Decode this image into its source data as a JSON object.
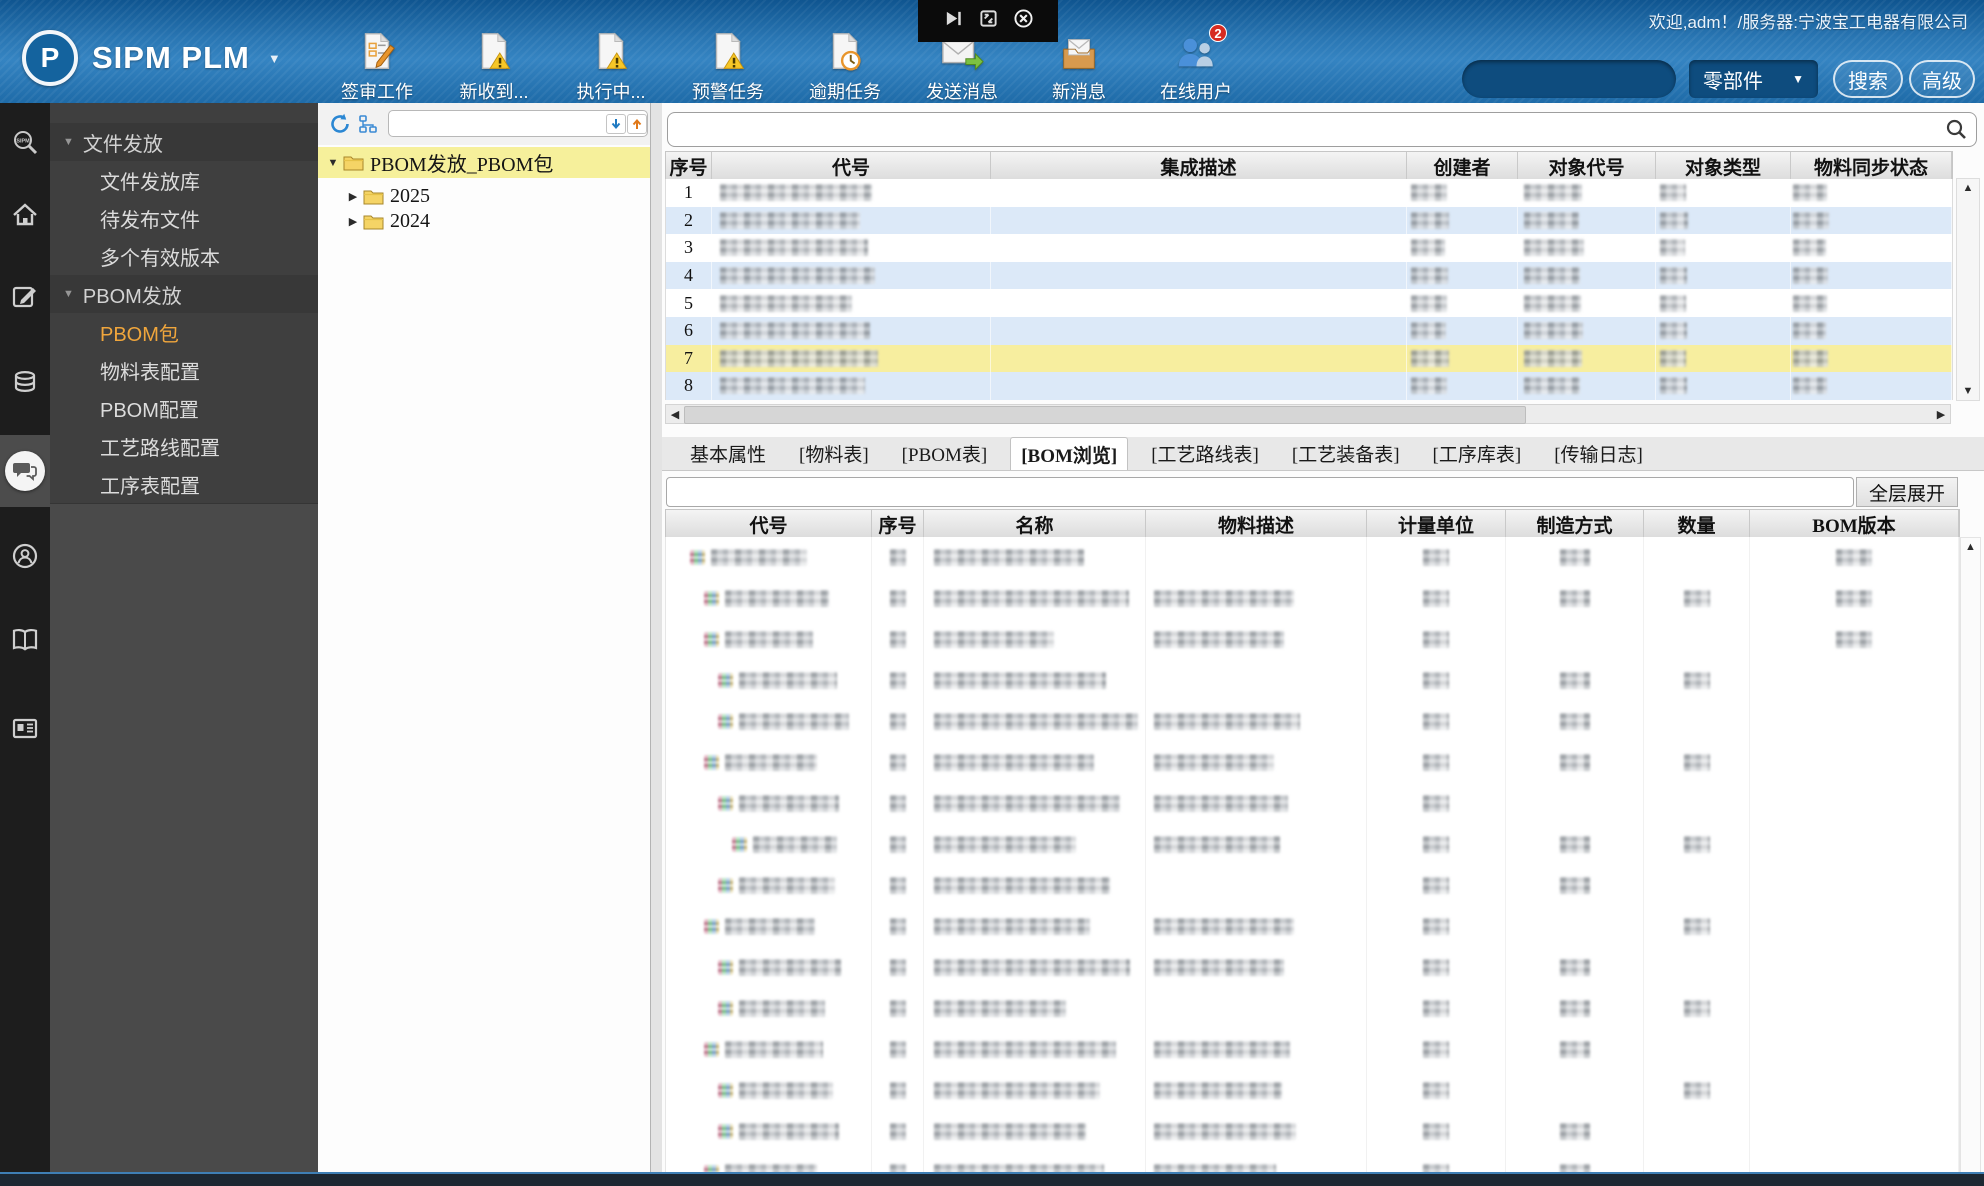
{
  "colors": {
    "header_blue": "#2a77b4",
    "accent_orange": "#f0a63c",
    "selection_yellow": "#f7ee9f",
    "row_alt_blue": "#dce9f8"
  },
  "capture_bar": {
    "icons": [
      "collapse-arrow",
      "resize-window",
      "close"
    ]
  },
  "header": {
    "logo_text": "SIPM PLM",
    "logo_letter": "P",
    "welcome": "欢迎,adm！/服务器:宁波宝工电器有限公司",
    "toolbar": [
      {
        "label": "签审工作",
        "icon": "approval-doc"
      },
      {
        "label": "新收到...",
        "icon": "doc-warning"
      },
      {
        "label": "执行中...",
        "icon": "doc-warning"
      },
      {
        "label": "预警任务",
        "icon": "doc-warning"
      },
      {
        "label": "逾期任务",
        "icon": "doc-clock"
      },
      {
        "label": "发送消息",
        "icon": "send-mail"
      },
      {
        "label": "新消息",
        "icon": "inbox-mail"
      },
      {
        "label": "在线用户",
        "icon": "online-users",
        "badge": "2"
      }
    ],
    "quick_search": {
      "value": "",
      "category": "零部件",
      "search_label": "搜索",
      "advanced_label": "高级"
    }
  },
  "sidebar": {
    "menu": [
      {
        "label": "文件发放",
        "type": "group"
      },
      {
        "label": "文件发放库",
        "type": "item"
      },
      {
        "label": "待发布文件",
        "type": "item"
      },
      {
        "label": "多个有效版本",
        "type": "item"
      },
      {
        "label": "PBOM发放",
        "type": "group"
      },
      {
        "label": "PBOM包",
        "type": "item",
        "selected": true
      },
      {
        "label": "物料表配置",
        "type": "item"
      },
      {
        "label": "PBOM配置",
        "type": "item"
      },
      {
        "label": "工艺路线配置",
        "type": "item"
      },
      {
        "label": "工序表配置",
        "type": "item"
      }
    ]
  },
  "tree": {
    "search_value": "",
    "root": "PBOM发放_PBOM包",
    "children": [
      "2025",
      "2024"
    ]
  },
  "main": {
    "search_value": "",
    "package_table": {
      "columns": [
        "序号",
        "代号",
        "集成描述",
        "创建者",
        "对象代号",
        "对象类型",
        "物料同步状态"
      ],
      "selected_row": "7",
      "rows": [
        {
          "num": "1",
          "code_w": 152,
          "creator_w": 36,
          "obj_w": 58,
          "type_w": 26,
          "sync_w": 34
        },
        {
          "num": "2",
          "code_w": 140,
          "creator_w": 38,
          "obj_w": 55,
          "type_w": 28,
          "sync_w": 36
        },
        {
          "num": "3",
          "code_w": 148,
          "creator_w": 34,
          "obj_w": 60,
          "type_w": 25,
          "sync_w": 33
        },
        {
          "num": "4",
          "code_w": 155,
          "creator_w": 37,
          "obj_w": 56,
          "type_w": 27,
          "sync_w": 35
        },
        {
          "num": "5",
          "code_w": 132,
          "creator_w": 36,
          "obj_w": 57,
          "type_w": 26,
          "sync_w": 34
        },
        {
          "num": "6",
          "code_w": 150,
          "creator_w": 35,
          "obj_w": 59,
          "type_w": 27,
          "sync_w": 33
        },
        {
          "num": "7",
          "code_w": 158,
          "creator_w": 38,
          "obj_w": 58,
          "type_w": 26,
          "sync_w": 35
        },
        {
          "num": "8",
          "code_w": 145,
          "creator_w": 36,
          "obj_w": 56,
          "type_w": 27,
          "sync_w": 34
        }
      ]
    },
    "tabs": [
      {
        "label": "基本属性"
      },
      {
        "label": "[物料表]"
      },
      {
        "label": "[PBOM表]"
      },
      {
        "label": "[BOM浏览]",
        "active": true
      },
      {
        "label": "[工艺路线表]"
      },
      {
        "label": "[工艺装备表]"
      },
      {
        "label": "[工序库表]"
      },
      {
        "label": "[传输日志]"
      }
    ],
    "filter_value": "",
    "expand_all_label": "全层展开",
    "bom_table": {
      "columns": [
        "代号",
        "序号",
        "名称",
        "物料描述",
        "计量单位",
        "制造方式",
        "数量",
        "BOM版本"
      ],
      "rows": [
        {
          "ind": 0,
          "code": 96,
          "name": 150,
          "desc": 0,
          "unit": 1,
          "mfg": 1,
          "qty": 0,
          "bom": 1
        },
        {
          "ind": 1,
          "code": 104,
          "name": 195,
          "desc": 140,
          "unit": 1,
          "mfg": 1,
          "qty": 1,
          "bom": 1
        },
        {
          "ind": 1,
          "code": 88,
          "name": 120,
          "desc": 130,
          "unit": 1,
          "mfg": 0,
          "qty": 0,
          "bom": 1
        },
        {
          "ind": 2,
          "code": 98,
          "name": 172,
          "desc": 0,
          "unit": 1,
          "mfg": 1,
          "qty": 1,
          "bom": 0
        },
        {
          "ind": 2,
          "code": 110,
          "name": 204,
          "desc": 146,
          "unit": 1,
          "mfg": 1,
          "qty": 0,
          "bom": 0
        },
        {
          "ind": 1,
          "code": 92,
          "name": 160,
          "desc": 120,
          "unit": 1,
          "mfg": 1,
          "qty": 1,
          "bom": 0
        },
        {
          "ind": 2,
          "code": 100,
          "name": 186,
          "desc": 134,
          "unit": 1,
          "mfg": 0,
          "qty": 0,
          "bom": 0
        },
        {
          "ind": 3,
          "code": 84,
          "name": 142,
          "desc": 126,
          "unit": 1,
          "mfg": 1,
          "qty": 1,
          "bom": 0
        },
        {
          "ind": 2,
          "code": 96,
          "name": 176,
          "desc": 0,
          "unit": 1,
          "mfg": 1,
          "qty": 0,
          "bom": 0
        },
        {
          "ind": 1,
          "code": 90,
          "name": 156,
          "desc": 140,
          "unit": 1,
          "mfg": 0,
          "qty": 1,
          "bom": 0
        },
        {
          "ind": 2,
          "code": 102,
          "name": 196,
          "desc": 130,
          "unit": 1,
          "mfg": 1,
          "qty": 0,
          "bom": 0
        },
        {
          "ind": 2,
          "code": 86,
          "name": 132,
          "desc": 0,
          "unit": 1,
          "mfg": 1,
          "qty": 1,
          "bom": 0
        },
        {
          "ind": 1,
          "code": 98,
          "name": 182,
          "desc": 136,
          "unit": 1,
          "mfg": 1,
          "qty": 0,
          "bom": 0
        },
        {
          "ind": 2,
          "code": 94,
          "name": 166,
          "desc": 128,
          "unit": 1,
          "mfg": 0,
          "qty": 1,
          "bom": 0
        },
        {
          "ind": 2,
          "code": 100,
          "name": 152,
          "desc": 142,
          "unit": 1,
          "mfg": 1,
          "qty": 0,
          "bom": 0
        },
        {
          "ind": 1,
          "code": 92,
          "name": 170,
          "desc": 122,
          "unit": 1,
          "mfg": 1,
          "qty": 0,
          "bom": 0
        }
      ]
    }
  }
}
